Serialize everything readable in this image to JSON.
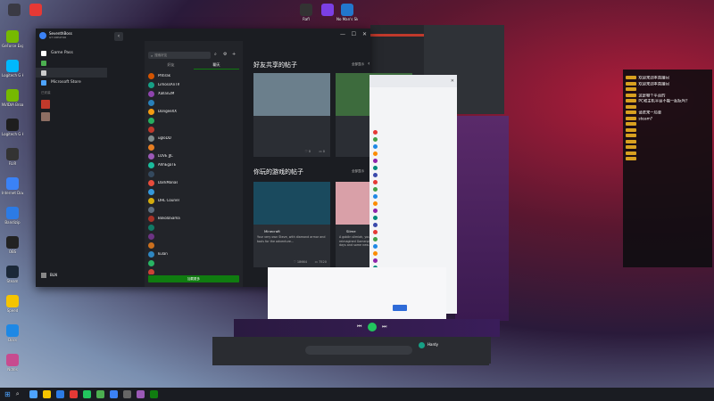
{
  "desktop_left": [
    {
      "label": "GeForce Experience",
      "color": "#76b900"
    },
    {
      "label": "Logitech G HUB",
      "color": "#00b8fc"
    },
    {
      "label": "NVIDIA Broadcast",
      "color": "#76b900"
    },
    {
      "label": "Logitech G HUB",
      "color": "#1e1e1e"
    },
    {
      "label": "FLIR",
      "color": "#333"
    },
    {
      "label": "Internet Down",
      "color": "#3b82f6"
    },
    {
      "label": "Bandizip",
      "color": "#2c7be5"
    },
    {
      "label": "OBS",
      "color": "#222"
    },
    {
      "label": "Steam",
      "color": "#1b2838"
    },
    {
      "label": "Speed",
      "color": "#f5c400"
    },
    {
      "label": "Docs",
      "color": "#1e88e5"
    },
    {
      "label": "Notes",
      "color": "#c74b8f"
    }
  ],
  "desktop_top": [
    {
      "label": "Rafl",
      "color": "#333"
    },
    {
      "label": "",
      "color": "#7b3fe4"
    },
    {
      "label": "No Man's Sky",
      "color": "#2277cc"
    }
  ],
  "desktop_top_left": [
    {
      "label": "",
      "color": "#3a3a44"
    },
    {
      "label": "",
      "color": "#e53935"
    }
  ],
  "xbox": {
    "user_name": "SeventhBoss",
    "user_tag": "GT CREATOR",
    "nav": [
      {
        "label": "Game Pass",
        "color": "#fff"
      },
      {
        "label": "",
        "color": "#4caf50"
      },
      {
        "label": "",
        "color": "#ccc"
      },
      {
        "label": "Microsoft Store",
        "color": "#4da3ff"
      }
    ],
    "section_label": "已安装",
    "games": [
      {
        "label": "",
        "color": "#c0392b"
      },
      {
        "label": "",
        "color": "#8d6e63"
      }
    ],
    "bottom_user": "BLN",
    "bottom_status": "",
    "social": {
      "search_placeholder": "搜索好友",
      "tabs": [
        "好友",
        "聊天"
      ],
      "active_tab": 1,
      "friends": [
        {
          "name": "Phtirak",
          "status": "",
          "color": "#d35400"
        },
        {
          "name": "LimossAnTR",
          "status": "",
          "color": "#16a085"
        },
        {
          "name": "Xallan2M",
          "status": "",
          "color": "#8e44ad"
        },
        {
          "name": "",
          "status": "",
          "color": "#2980b9"
        },
        {
          "name": "DongeeXX",
          "status": "",
          "color": "#f39c12"
        },
        {
          "name": "",
          "status": "",
          "color": "#27ae60"
        },
        {
          "name": "",
          "status": "",
          "color": "#c0392b"
        },
        {
          "name": "ugloDD",
          "status": "",
          "color": "#7f8c8d"
        },
        {
          "name": "",
          "status": "",
          "color": "#e67e22"
        },
        {
          "name": "LOVE JJC",
          "status": "",
          "color": "#9b59b6"
        },
        {
          "name": "AhhEgaTE",
          "status": "",
          "color": "#1abc9c"
        },
        {
          "name": "",
          "status": "",
          "color": "#34495e"
        },
        {
          "name": "DarkManas",
          "status": "",
          "color": "#e74c3c"
        },
        {
          "name": "",
          "status": "",
          "color": "#3498db"
        },
        {
          "name": "DHL Courier",
          "status": "",
          "color": "#d4ac0d"
        },
        {
          "name": "",
          "status": "",
          "color": "#5d6d7e"
        },
        {
          "name": "BokolaSama",
          "status": "",
          "color": "#a93226"
        },
        {
          "name": "",
          "status": "",
          "color": "#117a65"
        },
        {
          "name": "",
          "status": "",
          "color": "#6c3483"
        },
        {
          "name": "",
          "status": "",
          "color": "#ca6f1e"
        },
        {
          "name": "kulan",
          "status": "",
          "color": "#2e86c1"
        },
        {
          "name": "",
          "status": "",
          "color": "#28b463"
        },
        {
          "name": "",
          "status": "",
          "color": "#cb4335"
        },
        {
          "name": "",
          "status": "",
          "color": "#884ea0"
        },
        {
          "name": "SlowBakedPanda",
          "status": "",
          "color": "#239b56"
        }
      ],
      "footer_button": "加载更多"
    },
    "content": {
      "friends_posts_title": "好友共享的帖子",
      "games_posts_title": "你玩的游戏的帖子",
      "see_all": "全部显示",
      "posts": [
        {
          "user": "",
          "text": "",
          "time": "",
          "likes": "0",
          "comments": "0",
          "img": "#6b7f8c"
        },
        {
          "user": "",
          "text": "",
          "time": "",
          "likes": "0",
          "comments": "0",
          "img": "#3d6b3d"
        }
      ],
      "game_posts": [
        {
          "game": "Minecraft",
          "text": "Your very own Steve, with diamond armor and tools for the adventure...",
          "time": "",
          "likes": "18664",
          "comments": "7520",
          "img": "#1a4a5e"
        },
        {
          "game": "Slime",
          "text": "A goblin slimiah, you say? Switch it up with reimagined Gamerpics from the Xbox 360 days and some new...",
          "time": "",
          "likes": "10463",
          "comments": "386",
          "img": "#d9a0a8"
        }
      ]
    }
  },
  "chat_light": {
    "title": "",
    "items": [
      "",
      "",
      "",
      "",
      "",
      "",
      "",
      "",
      "",
      "",
      "",
      "",
      "",
      "",
      "",
      "",
      "",
      "",
      "",
      "",
      "",
      "",
      "",
      "",
      ""
    ]
  },
  "live": {
    "stats": [
      "",
      "",
      "",
      ""
    ],
    "tabs": [
      "",
      ""
    ],
    "messages": [
      {
        "user": "",
        "text": "欢迎来到本直播间"
      },
      {
        "user": "",
        "text": "欢迎来到本直播间"
      },
      {
        "user": "",
        "text": ""
      },
      {
        "user": "",
        "text": "这是哪个平台的"
      },
      {
        "user": "",
        "text": "PC和主机平台不能一起玩吗?"
      },
      {
        "user": "",
        "text": ""
      },
      {
        "user": "",
        "text": "请进来一局要"
      },
      {
        "user": "",
        "text": "steam?"
      },
      {
        "user": "",
        "text": ""
      },
      {
        "user": "",
        "text": ""
      },
      {
        "user": "",
        "text": ""
      },
      {
        "user": "",
        "text": ""
      },
      {
        "user": "",
        "text": ""
      },
      {
        "user": "",
        "text": ""
      },
      {
        "user": "",
        "text": ""
      }
    ]
  },
  "music": {
    "song": ""
  },
  "bottom_chat": {
    "input_placeholder": ""
  },
  "bottom_right_friend": {
    "name": "Hardy",
    "status": ""
  },
  "watermark": "",
  "taskbar": {
    "icons": [
      "#4da3ff",
      "#f5c400",
      "#2c7be5",
      "#e53935",
      "#22c55e",
      "#4caf50",
      "#3b82f6",
      "#666",
      "#9b59b6",
      "#107c10"
    ],
    "time": "",
    "date": ""
  }
}
